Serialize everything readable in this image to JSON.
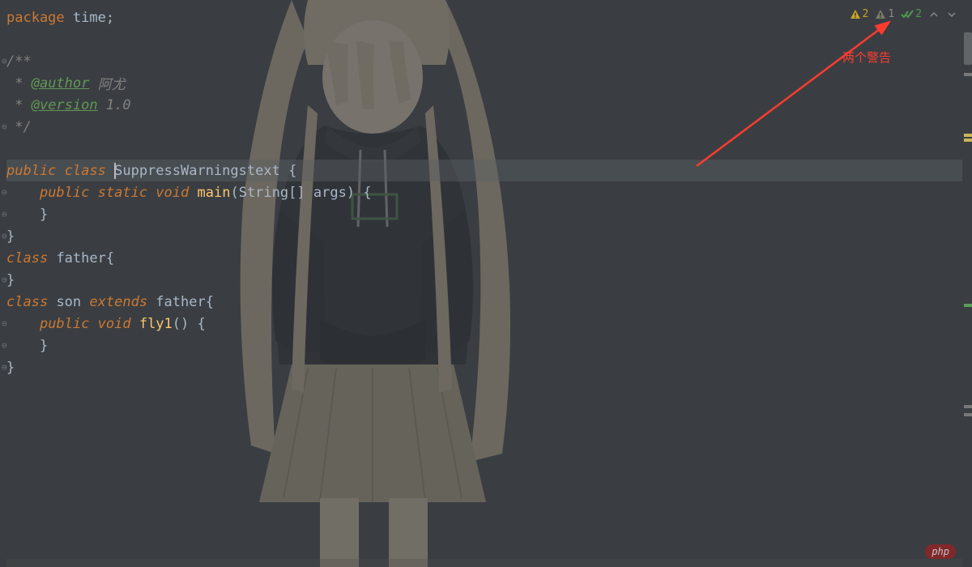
{
  "inspections": {
    "warning_count": "2",
    "weak_warning_count": "1",
    "ok_count": "2"
  },
  "annotation": {
    "text": "两个警告"
  },
  "code": {
    "line1_kw": "package",
    "line1_pkg": " time",
    "line1_semi": ";",
    "line3_open": "/**",
    "line4_star": " * ",
    "line4_tag": "@author",
    "line4_val": " 阿尤",
    "line5_star": " * ",
    "line5_tag": "@version",
    "line5_val": " 1.0",
    "line6_close": " */",
    "line8_public": "public",
    "line8_sp1": " ",
    "line8_class": "class",
    "line8_sp2": " ",
    "line8_name": "SuppressWarningstext",
    "line8_sp3": " ",
    "line8_brace": "{",
    "line9_indent": "    ",
    "line9_public": "public",
    "line9_sp1": " ",
    "line9_static": "static",
    "line9_sp2": " ",
    "line9_void": "void",
    "line9_sp3": " ",
    "line9_main": "main",
    "line9_paren_open": "(",
    "line9_string": "String",
    "line9_brackets": "[]",
    "line9_sp4": " ",
    "line9_args": "args",
    "line9_paren_close": ")",
    "line9_sp5": " ",
    "line9_brace": "{",
    "line10_indent": "    ",
    "line10_brace": "}",
    "line11_brace": "}",
    "line12_class": "class",
    "line12_sp1": " ",
    "line12_name": "father",
    "line12_brace": "{",
    "line13_brace": "}",
    "line14_class": "class",
    "line14_sp1": " ",
    "line14_name": "son",
    "line14_sp2": " ",
    "line14_extends": "extends",
    "line14_sp3": " ",
    "line14_parent": "father",
    "line14_brace": "{",
    "line15_indent": "    ",
    "line15_public": "public",
    "line15_sp1": " ",
    "line15_void": "void",
    "line15_sp2": " ",
    "line15_method": "fly1",
    "line15_parens": "()",
    "line15_sp3": " ",
    "line15_brace": "{",
    "line16_indent": "    ",
    "line16_brace": "}",
    "line17_brace": "}"
  },
  "watermark": "php"
}
